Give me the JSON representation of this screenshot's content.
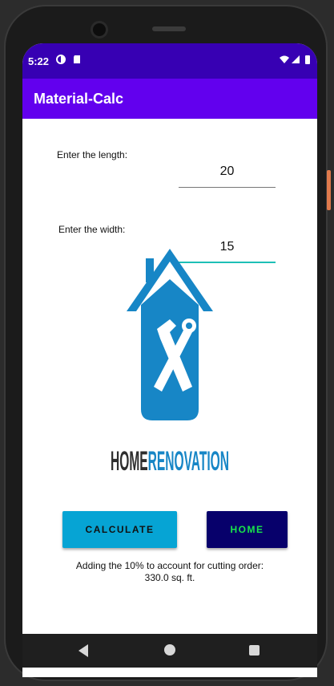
{
  "status_bar": {
    "time": "5:22"
  },
  "app_bar": {
    "title": "Material-Calc"
  },
  "form": {
    "length_label": "Enter the length:",
    "length_value": "20",
    "width_label": "Enter the width:",
    "width_value": "15"
  },
  "logo": {
    "text_dark": "HOME",
    "text_blue": "RENOVATION"
  },
  "buttons": {
    "calculate_label": "CALCULATE",
    "home_label": "HOME"
  },
  "result": {
    "text": "Adding the 10% to account for cutting order: 330.0 sq. ft."
  },
  "colors": {
    "status_bar": "#3700b3",
    "app_bar": "#6200ee",
    "calculate_bg": "#06a4d4",
    "home_bg": "#07006b",
    "home_text": "#18e54a",
    "logo_blue": "#1786c6"
  }
}
